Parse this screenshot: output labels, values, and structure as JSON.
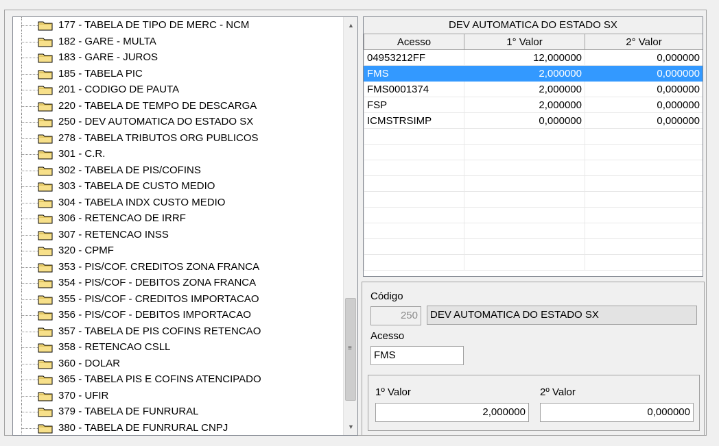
{
  "tree": {
    "items": [
      "177 - TABELA DE TIPO DE MERC - NCM",
      "182 - GARE - MULTA",
      "183 - GARE - JUROS",
      "185 - TABELA PIC",
      "201 - CODIGO DE PAUTA",
      "220 - TABELA DE TEMPO DE DESCARGA",
      "250 - DEV AUTOMATICA DO ESTADO SX",
      "278 - TABELA TRIBUTOS ORG PUBLICOS",
      "301 - C.R.",
      "302 - TABELA DE PIS/COFINS",
      "303 - TABELA DE CUSTO MEDIO",
      "304 - TABELA INDX CUSTO MEDIO",
      "306 - RETENCAO DE IRRF",
      "307 - RETENCAO INSS",
      "320 - CPMF",
      "353 - PIS/COF. CREDITOS ZONA FRANCA",
      "354 - PIS/COF - DEBITOS ZONA FRANCA",
      "355 - PIS/COF - CREDITOS IMPORTACAO",
      "356 - PIS/COF - DEBITOS IMPORTACAO",
      "357 - TABELA DE PIS COFINS RETENCAO",
      "358 - RETENCAO CSLL",
      "360 - DOLAR",
      "365 - TABELA PIS E COFINS ATENCIPADO",
      "370 - UFIR",
      "379 - TABELA DE FUNRURAL",
      "380 - TABELA DE FUNRURAL CNPJ"
    ],
    "scroll_up_glyph": "▲",
    "scroll_down_glyph": "▼",
    "scroll_grip_glyph": "≡"
  },
  "grid": {
    "title": "DEV AUTOMATICA DO ESTADO SX",
    "columns": [
      "Acesso",
      "1° Valor",
      "2° Valor"
    ],
    "rows": [
      {
        "acesso": "04953212FF",
        "v1": "12,000000",
        "v2": "0,000000"
      },
      {
        "acesso": "FMS",
        "v1": "2,000000",
        "v2": "0,000000",
        "selected": true
      },
      {
        "acesso": "FMS0001374",
        "v1": "2,000000",
        "v2": "0,000000"
      },
      {
        "acesso": "FSP",
        "v1": "2,000000",
        "v2": "0,000000"
      },
      {
        "acesso": "ICMSTRSIMP",
        "v1": "0,000000",
        "v2": "0,000000"
      }
    ],
    "empty_rows": 9,
    "selection_color": "#3399ff"
  },
  "detail": {
    "codigo_label": "Código",
    "codigo_value": "250",
    "descricao_value": "DEV AUTOMATICA DO ESTADO SX",
    "acesso_label": "Acesso",
    "acesso_value": "FMS",
    "valor1_label": "1º Valor",
    "valor1_value": "2,000000",
    "valor2_label": "2º Valor",
    "valor2_value": "0,000000"
  }
}
